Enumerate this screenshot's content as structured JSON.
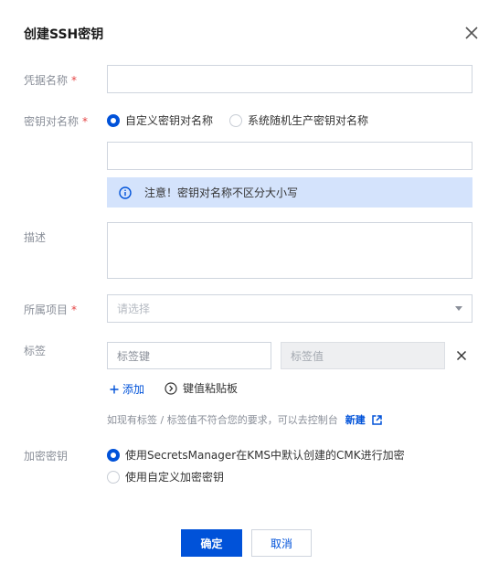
{
  "dialog": {
    "title": "创建SSH密钥"
  },
  "form": {
    "credential_name": {
      "label": "凭据名称",
      "required_mark": "*",
      "value": "",
      "placeholder": ""
    },
    "key_pair_name": {
      "label": "密钥对名称",
      "required_mark": "*",
      "options": [
        {
          "label": "自定义密钥对名称",
          "checked": true
        },
        {
          "label": "系统随机生产密钥对名称",
          "checked": false
        }
      ],
      "value": "",
      "notice": "注意！密钥对名称不区分大小写"
    },
    "description": {
      "label": "描述",
      "value": ""
    },
    "project": {
      "label": "所属项目",
      "required_mark": "*",
      "placeholder": "请选择"
    },
    "tags": {
      "label": "标签",
      "key_placeholder": "标签键",
      "value_placeholder": "标签值",
      "add_label": "添加",
      "clipboard_label": "键值粘贴板",
      "hint": "如现有标签 / 标签值不符合您的要求，可以去控制台",
      "new_link": "新建"
    },
    "encryption": {
      "label": "加密密钥",
      "options": [
        {
          "label": "使用SecretsManager在KMS中默认创建的CMK进行加密",
          "checked": true
        },
        {
          "label": "使用自定义加密密钥",
          "checked": false
        }
      ]
    }
  },
  "footer": {
    "confirm_label": "确定",
    "cancel_label": "取消"
  },
  "colors": {
    "primary": "#0052d9",
    "notice_bg": "#d4e3fc",
    "required": "#e54545"
  }
}
